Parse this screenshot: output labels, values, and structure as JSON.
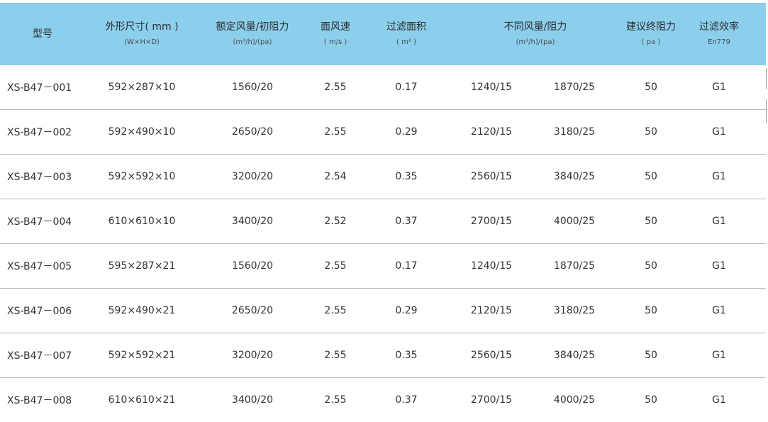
{
  "header": {
    "model": {
      "title": "型号"
    },
    "size": {
      "title": "外形尺寸( mm )",
      "sub": "(W×H×D)"
    },
    "rated": {
      "title": "额定风量/初阻力",
      "sub": "(m³/h)/(pa)"
    },
    "speed": {
      "title": "面风速",
      "sub": "( m/s )"
    },
    "area": {
      "title": "过滤面积",
      "sub": "( m² )"
    },
    "diff": {
      "title": "不同风量/阻力",
      "sub": "(m³/h)/(pa)"
    },
    "resistance": {
      "title": "建议终阻力",
      "sub": "( pa )"
    },
    "efficiency": {
      "title": "过滤效率",
      "sub": "En779"
    }
  },
  "rows": [
    {
      "model": "XS-B47－001",
      "size": "592×287×10",
      "rated": "1560/20",
      "speed": "2.55",
      "area": "0.17",
      "diff1": "1240/15",
      "diff2": "1870/25",
      "resistance": "50",
      "efficiency": "G1"
    },
    {
      "model": "XS-B47－002",
      "size": "592×490×10",
      "rated": "2650/20",
      "speed": "2.55",
      "area": "0.29",
      "diff1": "2120/15",
      "diff2": "3180/25",
      "resistance": "50",
      "efficiency": "G1"
    },
    {
      "model": "XS-B47－003",
      "size": "592×592×10",
      "rated": "3200/20",
      "speed": "2.54",
      "area": "0.35",
      "diff1": "2560/15",
      "diff2": "3840/25",
      "resistance": "50",
      "efficiency": "G1"
    },
    {
      "model": "XS-B47－004",
      "size": "610×610×10",
      "rated": "3400/20",
      "speed": "2.52",
      "area": "0.37",
      "diff1": "2700/15",
      "diff2": "4000/25",
      "resistance": "50",
      "efficiency": "G1"
    },
    {
      "model": "XS-B47－005",
      "size": "595×287×21",
      "rated": "1560/20",
      "speed": "2.55",
      "area": "0.17",
      "diff1": "1240/15",
      "diff2": "1870/25",
      "resistance": "50",
      "efficiency": "G1"
    },
    {
      "model": "XS-B47－006",
      "size": "592×490×21",
      "rated": "2650/20",
      "speed": "2.55",
      "area": "0.29",
      "diff1": "2120/15",
      "diff2": "3180/25",
      "resistance": "50",
      "efficiency": "G1"
    },
    {
      "model": "XS-B47－007",
      "size": "592×592×21",
      "rated": "3200/20",
      "speed": "2.55",
      "area": "0.35",
      "diff1": "2560/15",
      "diff2": "3840/25",
      "resistance": "50",
      "efficiency": "G1"
    },
    {
      "model": "XS-B47－008",
      "size": "610×610×21",
      "rated": "3400/20",
      "speed": "2.55",
      "area": "0.37",
      "diff1": "2700/15",
      "diff2": "4000/25",
      "resistance": "50",
      "efficiency": "G1"
    }
  ],
  "colors": {
    "header_bg": "#8ccfed",
    "divider": "#b9b9b9",
    "text": "#333333"
  }
}
